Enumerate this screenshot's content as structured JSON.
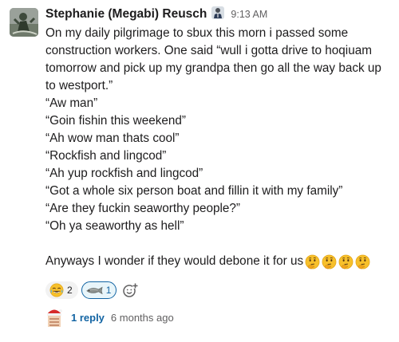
{
  "message": {
    "author": "Stephanie (Megabi) Reusch",
    "timestamp": "9:13 AM",
    "lines": [
      "On my daily pilgrimage to sbux this morn i passed some",
      "construction workers. One said “wull i gotta drive to hoqiuam",
      "tomorrow and pick up my grandpa then go all the way back up",
      "to westport.”",
      "“Aw man”",
      "“Goin fishin this weekend”",
      "“Ah wow man thats cool”",
      "“Rockfish and lingcod”",
      "“Ah yup rockfish and lingcod”",
      "“Got a whole six person boat and fillin it with my family”",
      "“Are they fuckin seaworthy people?”",
      "“Oh ya seaworthy as hell”"
    ],
    "final_line": "Anyways I wonder if they would debone it for us",
    "final_emojis": [
      "thinking-face",
      "thinking-face",
      "thinking-face",
      "thinking-face"
    ]
  },
  "reactions": [
    {
      "emoji": "joy-face",
      "count": "2",
      "active": false
    },
    {
      "emoji": "fish",
      "count": "1",
      "active": true
    }
  ],
  "thread": {
    "reply_count": "1 reply",
    "last_reply": "6 months ago"
  },
  "colors": {
    "link": "#1264a3",
    "text": "#1d1c1d",
    "muted": "#616061",
    "reaction_bg": "#f2f2f2",
    "reaction_active_bg": "#e8f5fa"
  }
}
